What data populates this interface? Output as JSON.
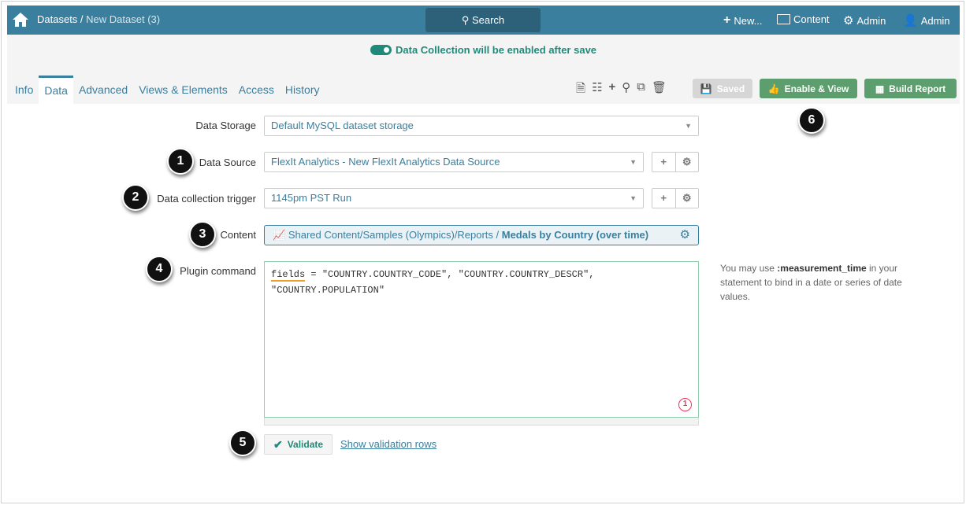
{
  "header": {
    "breadcrumb_root": "Datasets",
    "breadcrumb_sep": " / ",
    "breadcrumb_current": "New Dataset (3)",
    "search": "Search",
    "new": "New...",
    "content": "Content",
    "admin_settings": "Admin",
    "admin_user": "Admin"
  },
  "notice": "Data Collection will be enabled after save",
  "tabs": [
    "Info",
    "Data",
    "Advanced",
    "Views & Elements",
    "Access",
    "History"
  ],
  "toolbar": {
    "saved": "Saved",
    "enable_view": "Enable & View",
    "build_report": "Build Report"
  },
  "form": {
    "data_storage": {
      "label": "Data Storage",
      "value": "Default MySQL dataset storage"
    },
    "data_source": {
      "label": "Data Source",
      "value": "FlexIt Analytics - New FlexIt Analytics Data Source"
    },
    "trigger": {
      "label": "Data collection trigger",
      "value": "1145pm PST Run"
    },
    "content": {
      "label": "Content",
      "path": "Shared Content/Samples (Olympics)/Reports / ",
      "name": "Medals by Country (over time)"
    },
    "plugin": {
      "label": "Plugin command",
      "keyword": "fields",
      "rest": " = \"COUNTRY.COUNTRY_CODE\", \"COUNTRY.COUNTRY_DESCR\",",
      "line2": "\"COUNTRY.POPULATION\"",
      "error_count": "1"
    },
    "hint_pre": "You may use ",
    "hint_bold": ":measurement_time",
    "hint_post": " in your statement to bind in a date or series of date values.",
    "validate": "Validate",
    "show_rows": "Show validation rows"
  },
  "steps": [
    "1",
    "2",
    "3",
    "4",
    "5",
    "6"
  ]
}
